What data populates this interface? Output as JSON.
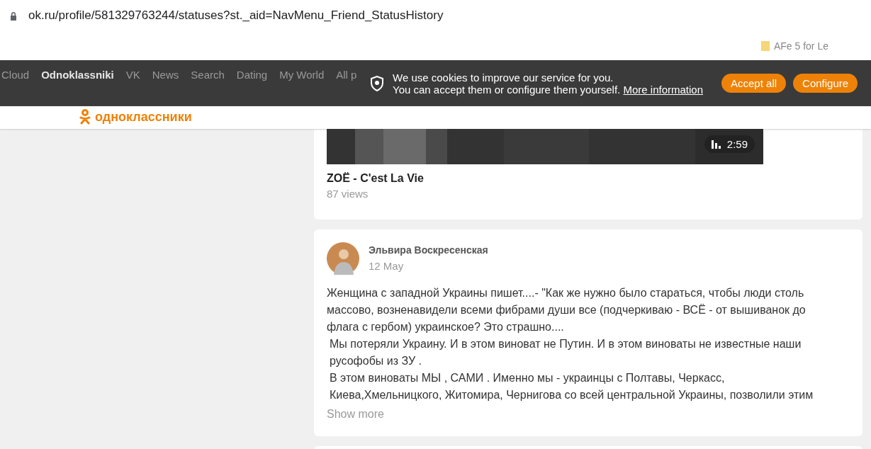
{
  "address_bar": {
    "url": "ok.ru/profile/581329763244/statuses?st._aid=NavMenu_Friend_StatusHistory"
  },
  "bookmarks": [
    {
      "label": "AFe 5 for Le"
    }
  ],
  "nav": {
    "items": [
      {
        "label": "Cloud",
        "selected": false
      },
      {
        "label": "Odnoklassniki",
        "selected": true
      },
      {
        "label": "VK",
        "selected": false
      },
      {
        "label": "News",
        "selected": false
      },
      {
        "label": "Search",
        "selected": false
      },
      {
        "label": "Dating",
        "selected": false
      },
      {
        "label": "My World",
        "selected": false
      },
      {
        "label": "All p",
        "selected": false
      }
    ]
  },
  "cookie_banner": {
    "line_1": "We use cookies to improve our service for you.",
    "line_2": "You can accept them or configure them yourself.",
    "link": "More information",
    "buttons": [
      "Accept all",
      "Configure"
    ]
  },
  "logo": {
    "text": "одноклассники"
  },
  "video": {
    "duration": "2:59",
    "title": "ZOЁ - C'est La Vie",
    "views": "87 views"
  },
  "post": {
    "author": "Эльвира Воскресенская",
    "date": "12 May",
    "paragraphs": [
      "Женщина с западной Украины пишет....- \"Как же нужно было стараться, чтобы люди столь массово, возненавидели всеми фибрами души все (подчеркиваю - ВСЁ - от вышиванок до флага с гербом) украинское? Это страшно....",
      "Мы потеряли Украину. И в этом виноват не Путин. И в этом виноваты не известные наши русофобы из ЗУ .",
      "В этом виноваты МЫ , САМИ . Именно мы - украинцы с Полтавы, Черкасс, Киева,Хмельницкого, Житомира, Чернигова со всей центральной Украины, позволили этим"
    ],
    "show_more": "Show more"
  }
}
